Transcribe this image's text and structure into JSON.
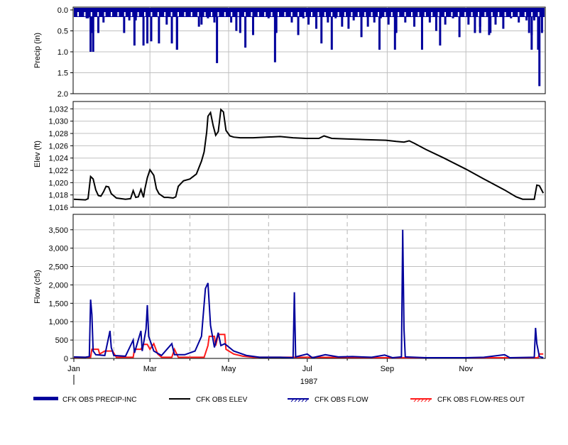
{
  "colors": {
    "precip": "#00009c",
    "elev": "#000000",
    "flow": "#00009c",
    "res_out": "#ff1a1a",
    "grid": "#c0c0c0",
    "dashed": "#b4b4b4"
  },
  "x_axis": {
    "months": [
      "Jan",
      "Mar",
      "May",
      "Jul",
      "Sep",
      "Nov"
    ],
    "year": "1987"
  },
  "chart_data": [
    {
      "type": "bar",
      "ylabel": "Precip (in)",
      "ylim": [
        0,
        2.0
      ],
      "y_inverted": true,
      "yticks": [
        "0.0",
        "0.5",
        "1.0",
        "1.5",
        "2.0"
      ],
      "grid": true,
      "series": [
        {
          "name": "CFK OBS PRECIP-INC",
          "x": [
            "1987-01-03",
            "1987-01-08",
            "1987-01-11",
            "1987-01-12",
            "1987-01-16",
            "1987-01-20",
            "1987-01-24",
            "1987-01-27",
            "1987-02-04",
            "1987-02-09",
            "1987-02-13",
            "1987-02-18",
            "1987-02-21",
            "1987-02-23",
            "1987-02-27",
            "1987-03-03",
            "1987-03-08",
            "1987-03-14",
            "1987-03-18",
            "1987-03-22",
            "1987-03-29",
            "1987-04-03",
            "1987-04-08",
            "1987-04-10",
            "1987-04-15",
            "1987-04-20",
            "1987-04-27",
            "1987-05-03",
            "1987-05-07",
            "1987-05-14",
            "1987-05-20",
            "1987-05-25",
            "1987-06-01",
            "1987-06-06",
            "1987-06-14",
            "1987-06-19",
            "1987-06-24",
            "1987-06-28",
            "1987-07-02",
            "1987-07-08",
            "1987-07-12",
            "1987-07-17",
            "1987-07-23",
            "1987-07-28",
            "1987-08-02",
            "1987-08-06",
            "1987-08-12",
            "1987-08-17",
            "1987-08-22",
            "1987-08-27",
            "1987-09-02",
            "1987-09-08",
            "1987-09-15",
            "1987-09-22",
            "1987-09-28",
            "1987-10-04",
            "1987-10-09",
            "1987-10-16",
            "1987-10-22",
            "1987-10-27",
            "1987-11-03",
            "1987-11-08",
            "1987-11-12",
            "1987-11-19",
            "1987-11-24",
            "1987-11-30",
            "1987-12-06",
            "1987-12-12",
            "1987-12-18",
            "1987-12-20",
            "1987-12-22",
            "1987-12-24",
            "1987-12-27",
            "1987-12-30"
          ],
          "values": [
            0.15,
            0.1,
            0.2,
            0.2,
            1.0,
            0.55,
            0.3,
            0.1,
            0.15,
            0.55,
            0.25,
            0.25,
            0.1,
            0.1,
            0.8,
            0.15,
            0.8,
            0.35,
            0.8,
            0.95,
            0.15,
            0.15,
            0.4,
            0.35,
            0.2,
            0.3,
            0.1,
            0.3,
            0.5,
            0.9,
            0.6,
            0.1,
            0.2,
            1.25,
            0.15,
            0.3,
            0.6,
            0.2,
            0.35,
            0.45,
            0.8,
            0.3,
            0.2,
            0.4,
            0.45,
            0.25,
            0.65,
            0.4,
            0.3,
            0.2,
            0.35,
            0.55,
            0.3,
            0.4,
            0.95,
            0.3,
            0.5,
            0.35,
            0.2,
            0.65,
            0.35,
            0.55,
            0.4,
            0.6,
            0.35,
            0.45,
            0.2,
            0.3,
            0.25,
            0.55,
            0.95,
            0.25,
            0.95,
            0.55
          ],
          "big": [
            {
              "x": "1987-01-14",
              "v": 1.0
            },
            {
              "x": "1987-03-22",
              "v": 0.95
            },
            {
              "x": "1987-04-22",
              "v": 1.27
            },
            {
              "x": "1987-07-20",
              "v": 0.95
            },
            {
              "x": "1987-08-26",
              "v": 0.95
            },
            {
              "x": "1987-09-07",
              "v": 0.95
            },
            {
              "x": "1987-12-28",
              "v": 1.82
            },
            {
              "x": "1987-12-22",
              "v": 0.6
            },
            {
              "x": "1987-11-12",
              "v": 0.55
            },
            {
              "x": "1987-11-20",
              "v": 0.55
            },
            {
              "x": "1987-10-12",
              "v": 0.85
            },
            {
              "x": "1987-05-10",
              "v": 0.55
            },
            {
              "x": "1987-06-07",
              "v": 0.55
            },
            {
              "x": "1987-03-02",
              "v": 0.75
            },
            {
              "x": "1987-02-24",
              "v": 0.85
            },
            {
              "x": "1987-02-17",
              "v": 0.85
            },
            {
              "x": "1987-01-15",
              "v": 0.55
            }
          ]
        }
      ]
    },
    {
      "type": "line",
      "ylabel": "Elev (ft)",
      "ylim": [
        1016,
        1033.2
      ],
      "yticks": [
        "1,016",
        "1,018",
        "1,020",
        "1,022",
        "1,024",
        "1,026",
        "1,028",
        "1,030",
        "1,032"
      ],
      "grid": true,
      "series": [
        {
          "name": "CFK OBS ELEV",
          "points": [
            [
              "1987-01-01",
              1017.3
            ],
            [
              "1987-01-10",
              1017.2
            ],
            [
              "1987-01-12",
              1017.4
            ],
            [
              "1987-01-14",
              1021.0
            ],
            [
              "1987-01-16",
              1020.6
            ],
            [
              "1987-01-18",
              1018.8
            ],
            [
              "1987-01-20",
              1017.9
            ],
            [
              "1987-01-22",
              1017.8
            ],
            [
              "1987-01-24",
              1018.5
            ],
            [
              "1987-01-26",
              1019.4
            ],
            [
              "1987-01-28",
              1019.3
            ],
            [
              "1987-01-30",
              1018.2
            ],
            [
              "1987-02-03",
              1017.5
            ],
            [
              "1987-02-10",
              1017.3
            ],
            [
              "1987-02-14",
              1017.4
            ],
            [
              "1987-02-16",
              1018.7
            ],
            [
              "1987-02-18",
              1017.6
            ],
            [
              "1987-02-20",
              1017.7
            ],
            [
              "1987-02-22",
              1018.9
            ],
            [
              "1987-02-24",
              1017.6
            ],
            [
              "1987-02-25",
              1018.9
            ],
            [
              "1987-02-27",
              1020.8
            ],
            [
              "1987-03-01",
              1022.1
            ],
            [
              "1987-03-04",
              1021.2
            ],
            [
              "1987-03-06",
              1019.0
            ],
            [
              "1987-03-08",
              1018.2
            ],
            [
              "1987-03-12",
              1017.6
            ],
            [
              "1987-03-15",
              1017.6
            ],
            [
              "1987-03-19",
              1017.5
            ],
            [
              "1987-03-21",
              1017.7
            ],
            [
              "1987-03-23",
              1019.4
            ],
            [
              "1987-03-27",
              1020.3
            ],
            [
              "1987-04-01",
              1020.6
            ],
            [
              "1987-04-06",
              1021.4
            ],
            [
              "1987-04-10",
              1023.5
            ],
            [
              "1987-04-12",
              1025.0
            ],
            [
              "1987-04-14",
              1028.2
            ],
            [
              "1987-04-15",
              1030.8
            ],
            [
              "1987-04-17",
              1031.4
            ],
            [
              "1987-04-19",
              1029.3
            ],
            [
              "1987-04-21",
              1027.7
            ],
            [
              "1987-04-23",
              1028.3
            ],
            [
              "1987-04-25",
              1031.9
            ],
            [
              "1987-04-27",
              1031.5
            ],
            [
              "1987-04-29",
              1028.5
            ],
            [
              "1987-05-02",
              1027.6
            ],
            [
              "1987-05-05",
              1027.4
            ],
            [
              "1987-05-10",
              1027.3
            ],
            [
              "1987-05-20",
              1027.3
            ],
            [
              "1987-05-30",
              1027.4
            ],
            [
              "1987-06-10",
              1027.5
            ],
            [
              "1987-06-20",
              1027.3
            ],
            [
              "1987-06-30",
              1027.2
            ],
            [
              "1987-07-10",
              1027.2
            ],
            [
              "1987-07-14",
              1027.6
            ],
            [
              "1987-07-20",
              1027.2
            ],
            [
              "1987-07-31",
              1027.1
            ],
            [
              "1987-08-15",
              1027.0
            ],
            [
              "1987-08-31",
              1026.9
            ],
            [
              "1987-09-08",
              1026.7
            ],
            [
              "1987-09-14",
              1026.6
            ],
            [
              "1987-09-18",
              1026.8
            ],
            [
              "1987-09-22",
              1026.4
            ],
            [
              "1987-10-01",
              1025.4
            ],
            [
              "1987-10-15",
              1024.0
            ],
            [
              "1987-11-01",
              1022.2
            ],
            [
              "1987-11-15",
              1020.6
            ],
            [
              "1987-12-01",
              1018.8
            ],
            [
              "1987-12-10",
              1017.7
            ],
            [
              "1987-12-15",
              1017.3
            ],
            [
              "1987-12-24",
              1017.3
            ],
            [
              "1987-12-26",
              1019.6
            ],
            [
              "1987-12-28",
              1019.5
            ],
            [
              "1987-12-31",
              1018.3
            ]
          ]
        }
      ]
    },
    {
      "type": "line",
      "ylabel": "Flow (cfs)",
      "ylim": [
        0,
        3920
      ],
      "yticks": [
        "0",
        "500",
        "1,000",
        "1,500",
        "2,000",
        "2,500",
        "3,000",
        "3,500"
      ],
      "grid": true,
      "series": [
        {
          "name": "CFK OBS FLOW",
          "points": [
            [
              "1987-01-01",
              40
            ],
            [
              "1987-01-10",
              30
            ],
            [
              "1987-01-13",
              50
            ],
            [
              "1987-01-14",
              1600
            ],
            [
              "1987-01-15",
              1200
            ],
            [
              "1987-01-16",
              200
            ],
            [
              "1987-01-18",
              100
            ],
            [
              "1987-01-25",
              80
            ],
            [
              "1987-01-29",
              750
            ],
            [
              "1987-01-30",
              300
            ],
            [
              "1987-02-01",
              80
            ],
            [
              "1987-02-10",
              60
            ],
            [
              "1987-02-16",
              500
            ],
            [
              "1987-02-17",
              150
            ],
            [
              "1987-02-22",
              750
            ],
            [
              "1987-02-23",
              200
            ],
            [
              "1987-02-26",
              800
            ],
            [
              "1987-02-27",
              1450
            ],
            [
              "1987-02-28",
              600
            ],
            [
              "1987-03-02",
              400
            ],
            [
              "1987-03-04",
              200
            ],
            [
              "1987-03-10",
              80
            ],
            [
              "1987-03-18",
              400
            ],
            [
              "1987-03-20",
              100
            ],
            [
              "1987-03-28",
              100
            ],
            [
              "1987-04-05",
              200
            ],
            [
              "1987-04-10",
              600
            ],
            [
              "1987-04-13",
              1900
            ],
            [
              "1987-04-15",
              2050
            ],
            [
              "1987-04-17",
              900
            ],
            [
              "1987-04-20",
              300
            ],
            [
              "1987-04-23",
              700
            ],
            [
              "1987-04-25",
              350
            ],
            [
              "1987-04-28",
              400
            ],
            [
              "1987-05-05",
              200
            ],
            [
              "1987-05-15",
              80
            ],
            [
              "1987-05-25",
              30
            ],
            [
              "1987-06-10",
              30
            ],
            [
              "1987-06-20",
              20
            ],
            [
              "1987-06-21",
              1800
            ],
            [
              "1987-06-22",
              40
            ],
            [
              "1987-07-01",
              120
            ],
            [
              "1987-07-05",
              20
            ],
            [
              "1987-07-15",
              100
            ],
            [
              "1987-07-25",
              40
            ],
            [
              "1987-08-05",
              50
            ],
            [
              "1987-08-20",
              30
            ],
            [
              "1987-08-30",
              90
            ],
            [
              "1987-09-05",
              20
            ],
            [
              "1987-09-12",
              40
            ],
            [
              "1987-09-13",
              3500
            ],
            [
              "1987-09-14",
              800
            ],
            [
              "1987-09-15",
              40
            ],
            [
              "1987-10-01",
              20
            ],
            [
              "1987-11-01",
              20
            ],
            [
              "1987-11-15",
              30
            ],
            [
              "1987-12-01",
              100
            ],
            [
              "1987-12-05",
              20
            ],
            [
              "1987-12-24",
              30
            ],
            [
              "1987-12-25",
              830
            ],
            [
              "1987-12-26",
              400
            ],
            [
              "1987-12-28",
              50
            ],
            [
              "1987-12-31",
              20
            ]
          ]
        },
        {
          "name": "CFK OBS FLOW-RES OUT",
          "points": [
            [
              "1987-01-01",
              30
            ],
            [
              "1987-01-14",
              30
            ],
            [
              "1987-01-15",
              250
            ],
            [
              "1987-01-20",
              250
            ],
            [
              "1987-01-21",
              120
            ],
            [
              "1987-01-25",
              200
            ],
            [
              "1987-01-31",
              200
            ],
            [
              "1987-02-03",
              30
            ],
            [
              "1987-02-16",
              30
            ],
            [
              "1987-02-17",
              250
            ],
            [
              "1987-02-22",
              250
            ],
            [
              "1987-02-24",
              380
            ],
            [
              "1987-02-27",
              380
            ],
            [
              "1987-03-01",
              250
            ],
            [
              "1987-03-04",
              400
            ],
            [
              "1987-03-07",
              120
            ],
            [
              "1987-03-10",
              30
            ],
            [
              "1987-03-18",
              30
            ],
            [
              "1987-03-20",
              250
            ],
            [
              "1987-03-23",
              30
            ],
            [
              "1987-04-12",
              30
            ],
            [
              "1987-04-15",
              350
            ],
            [
              "1987-04-16",
              600
            ],
            [
              "1987-04-20",
              600
            ],
            [
              "1987-04-21",
              350
            ],
            [
              "1987-04-23",
              650
            ],
            [
              "1987-04-28",
              650
            ],
            [
              "1987-04-29",
              250
            ],
            [
              "1987-05-05",
              120
            ],
            [
              "1987-05-12",
              60
            ],
            [
              "1987-05-20",
              30
            ],
            [
              "1987-07-01",
              30
            ],
            [
              "1987-09-01",
              20
            ],
            [
              "1987-11-01",
              20
            ],
            [
              "1987-12-27",
              20
            ],
            [
              "1987-12-28",
              120
            ],
            [
              "1987-12-31",
              120
            ]
          ]
        }
      ]
    }
  ]
}
